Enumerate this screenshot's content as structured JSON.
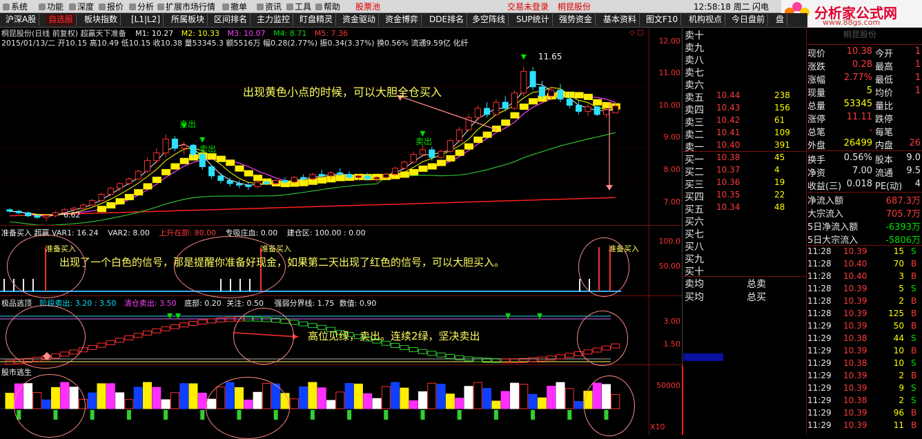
{
  "menu": {
    "items": [
      "系统",
      "功能",
      "深度",
      "报价",
      "分析",
      "扩展市场行情",
      "撤单",
      "资讯",
      "工具",
      "帮助"
    ],
    "stockpool": "股票池",
    "trade_status": "交易未登录",
    "stock_name": "桐昆股份",
    "clock": "12:58:18 周二",
    "flash": "闪电",
    "logo_main": "分析家公式网",
    "logo_url": "www.88gs.com"
  },
  "tabs": [
    "沪深A股",
    "自选股",
    "板块指数",
    "[L1|L2]",
    "所属板块",
    "区间排名",
    "主力监控",
    "盯盘精灵",
    "资金驱动",
    "资金博弈",
    "DDE排名",
    "多空阵线",
    "SUP统计",
    "强势资金",
    "基本资料",
    "图文F10",
    "机构视点",
    "今日盘前",
    "盘"
  ],
  "main_chart": {
    "title": "桐昆股份(日线 前复权) 超赢天下准备",
    "m1": "M1: 10.27",
    "m2": "M2: 10.33",
    "m3": "M3: 10.07",
    "m4": "M4: 8.71",
    "m5": "M5: 7.36",
    "ohlc": "2015/01/13/二 开10.15 高10.49 低10.15 收10.38 量53345.3 额5516万 幅0.28(2.77%) 振0.34(3.37%) 换0.56% 流通9.59亿 化纤",
    "y_ticks": [
      "12.00",
      "11.00",
      "10.00",
      "9.00",
      "8.00",
      "7.00"
    ],
    "high_label": "11.65",
    "low_label": "6.62",
    "sell_label": "卖出",
    "annotation": "出现黄色小点的时候，可以大胆全仓买入"
  },
  "panel2": {
    "title": "准备买入 超赢 VAR1: 16.24",
    "var2": "VAR2: 8.00",
    "rise": "上升在即: 80.00",
    "absorb": "专吸庄血: 0.00",
    "build": "建仓区: 100.00 : 0.00",
    "label": "准备买入",
    "y_ticks": [
      "100.0",
      "50.00"
    ],
    "annotation": "出现了一个白色的信号，那是提醒你准备好现金，如果第二天出现了红色的信号，可以大胆买入。"
  },
  "panel3": {
    "title": "极品逃顶",
    "stage": "阶段卖出: 3.20 : 3.50",
    "clear": "清仓卖出: 3.50",
    "bottom": "底部: 0.20",
    "attn": "关注: 0.50",
    "divider": "强弱分界线: 1.75",
    "value": "数值: 0.90",
    "y_ticks": [
      "3.00",
      "1.50"
    ],
    "annotation": "高位见绿，卖出。连续2绿，坚决卖出"
  },
  "panel4": {
    "title": "股市逃生",
    "y_tick": "50000",
    "scale": "X10"
  },
  "orderbook": {
    "sells": [
      {
        "label": "卖十",
        "price": "",
        "vol": ""
      },
      {
        "label": "卖九",
        "price": "",
        "vol": ""
      },
      {
        "label": "卖八",
        "price": "",
        "vol": ""
      },
      {
        "label": "卖七",
        "price": "",
        "vol": ""
      },
      {
        "label": "卖六",
        "price": "",
        "vol": ""
      },
      {
        "label": "卖五",
        "price": "10.44",
        "vol": "238"
      },
      {
        "label": "卖四",
        "price": "10.43",
        "vol": "156"
      },
      {
        "label": "卖三",
        "price": "10.42",
        "vol": "61"
      },
      {
        "label": "卖二",
        "price": "10.41",
        "vol": "109"
      },
      {
        "label": "卖一",
        "price": "10.40",
        "vol": "391"
      }
    ],
    "buys": [
      {
        "label": "买一",
        "price": "10.38",
        "vol": "45"
      },
      {
        "label": "买二",
        "price": "10.37",
        "vol": "4"
      },
      {
        "label": "买三",
        "price": "10.36",
        "vol": "19"
      },
      {
        "label": "买四",
        "price": "10.35",
        "vol": "22"
      },
      {
        "label": "买五",
        "price": "10.34",
        "vol": "48"
      },
      {
        "label": "买六",
        "price": "",
        "vol": ""
      },
      {
        "label": "买七",
        "price": "",
        "vol": ""
      },
      {
        "label": "买八",
        "price": "",
        "vol": ""
      },
      {
        "label": "买九",
        "price": "",
        "vol": ""
      },
      {
        "label": "买十",
        "price": "",
        "vol": ""
      }
    ],
    "sell_avg": "卖均",
    "sell_total": "总卖",
    "buy_avg": "买均",
    "buy_total": "总买"
  },
  "quote": {
    "header": "桐昆股份",
    "rows": [
      {
        "l1": "现价",
        "v1": "10.38",
        "l2": "今开",
        "v2": "1"
      },
      {
        "l1": "涨跌",
        "v1": "0.28",
        "l2": "最高",
        "v2": "1"
      },
      {
        "l1": "涨幅",
        "v1": "2.77%",
        "l2": "最低",
        "v2": "1"
      },
      {
        "l1": "现量",
        "v1": "5",
        "l2": "均价",
        "v2": "1"
      },
      {
        "l1": "总量",
        "v1": "53345",
        "l2": "量比",
        "v2": ""
      },
      {
        "l1": "涨停",
        "v1": "11.11",
        "l2": "跌停",
        "v2": ""
      },
      {
        "l1": "总笔",
        "v1": "-",
        "l2": "每笔",
        "v2": ""
      },
      {
        "l1": "外盘",
        "v1": "26499",
        "l2": "内盘",
        "v2": "26"
      }
    ],
    "rows2": [
      {
        "l1": "换手",
        "v1": "0.56%",
        "l2": "股本",
        "v2": "9.0"
      },
      {
        "l1": "净资",
        "v1": "7.00",
        "l2": "流通",
        "v2": "9.5"
      },
      {
        "l1": "收益(三)",
        "v1": "0.018",
        "l2": "PE(动)",
        "v2": "4"
      }
    ],
    "flows": [
      {
        "label": "净流入额",
        "value": "687.3万"
      },
      {
        "label": "大宗流入",
        "value": "705.7万"
      },
      {
        "label": "5日净流入额",
        "value": "-6393万"
      },
      {
        "label": "5日大宗流入",
        "value": "-5806万"
      }
    ]
  },
  "ticks": [
    {
      "time": "11:28",
      "price": "10.39",
      "vol": "15",
      "side": "S"
    },
    {
      "time": "11:28",
      "price": "10.40",
      "vol": "70",
      "side": "B"
    },
    {
      "time": "11:28",
      "price": "10.40",
      "vol": "3",
      "side": "B"
    },
    {
      "time": "11:28",
      "price": "10.39",
      "vol": "5",
      "side": "S"
    },
    {
      "time": "11:28",
      "price": "10.39",
      "vol": "2",
      "side": "B"
    },
    {
      "time": "11:28",
      "price": "10.39",
      "vol": "125",
      "side": "B"
    },
    {
      "time": "11:29",
      "price": "10.39",
      "vol": "50",
      "side": "B"
    },
    {
      "time": "11:29",
      "price": "10.38",
      "vol": "44",
      "side": "S"
    },
    {
      "time": "11:29",
      "price": "10.39",
      "vol": "10",
      "side": "B"
    },
    {
      "time": "11:29",
      "price": "10.38",
      "vol": "10",
      "side": "S"
    },
    {
      "time": "11:29",
      "price": "10.39",
      "vol": "2",
      "side": "B"
    },
    {
      "time": "11:29",
      "price": "10.39",
      "vol": "9",
      "side": "S"
    },
    {
      "time": "11:29",
      "price": "10.38",
      "vol": "2",
      "side": "S"
    },
    {
      "time": "11:29",
      "price": "10.39",
      "vol": "96",
      "side": "B"
    },
    {
      "time": "11:29",
      "price": "10.39",
      "vol": "11",
      "side": "B"
    }
  ],
  "chart_data": {
    "type": "candlestick",
    "y_range": [
      6.5,
      12.3
    ],
    "candles": [
      [
        7.0,
        7.05,
        6.9,
        6.95
      ],
      [
        6.95,
        7.0,
        6.85,
        6.9
      ],
      [
        6.9,
        6.95,
        6.75,
        6.8
      ],
      [
        6.8,
        6.85,
        6.7,
        6.75
      ],
      [
        6.75,
        6.85,
        6.62,
        6.8
      ],
      [
        6.8,
        6.95,
        6.75,
        6.9
      ],
      [
        6.9,
        7.05,
        6.85,
        7.0
      ],
      [
        7.0,
        7.1,
        6.95,
        7.05
      ],
      [
        7.05,
        7.2,
        7.0,
        7.15
      ],
      [
        7.15,
        7.35,
        7.1,
        7.3
      ],
      [
        7.3,
        7.55,
        7.25,
        7.5
      ],
      [
        7.5,
        7.75,
        7.45,
        7.7
      ],
      [
        7.7,
        7.9,
        7.6,
        7.85
      ],
      [
        7.85,
        8.05,
        7.8,
        8.0
      ],
      [
        8.0,
        8.3,
        7.95,
        8.25
      ],
      [
        8.25,
        8.7,
        8.2,
        8.6
      ],
      [
        8.6,
        9.0,
        8.5,
        8.85
      ],
      [
        8.85,
        9.45,
        8.7,
        9.3
      ],
      [
        9.3,
        9.4,
        8.9,
        9.0
      ],
      [
        9.0,
        9.2,
        8.8,
        9.1
      ],
      [
        9.1,
        9.15,
        8.7,
        8.8
      ],
      [
        8.8,
        8.9,
        8.3,
        8.4
      ],
      [
        8.4,
        8.45,
        8.0,
        8.1
      ],
      [
        8.1,
        8.2,
        7.85,
        7.95
      ],
      [
        7.95,
        8.05,
        7.75,
        7.85
      ],
      [
        7.85,
        7.95,
        7.7,
        7.8
      ],
      [
        7.8,
        7.9,
        7.65,
        7.75
      ],
      [
        7.75,
        7.95,
        7.7,
        7.9
      ],
      [
        7.9,
        8.0,
        7.8,
        7.85
      ],
      [
        7.85,
        8.0,
        7.8,
        7.95
      ],
      [
        7.95,
        8.05,
        7.85,
        7.9
      ],
      [
        7.9,
        8.1,
        7.85,
        8.05
      ],
      [
        8.05,
        8.15,
        7.95,
        8.0
      ],
      [
        8.0,
        8.2,
        7.95,
        8.15
      ],
      [
        8.15,
        8.3,
        8.05,
        8.1
      ],
      [
        8.1,
        8.25,
        8.0,
        8.2
      ],
      [
        8.2,
        8.35,
        8.1,
        8.15
      ],
      [
        8.15,
        8.25,
        8.0,
        8.05
      ],
      [
        8.05,
        8.15,
        7.95,
        8.1
      ],
      [
        8.1,
        8.2,
        7.95,
        8.0
      ],
      [
        8.0,
        8.1,
        7.9,
        8.05
      ],
      [
        8.05,
        8.2,
        8.0,
        8.15
      ],
      [
        8.15,
        8.4,
        8.1,
        8.35
      ],
      [
        8.35,
        8.6,
        8.3,
        8.55
      ],
      [
        8.55,
        8.9,
        8.5,
        8.8
      ],
      [
        8.8,
        9.1,
        8.7,
        8.95
      ],
      [
        8.95,
        9.05,
        8.6,
        8.7
      ],
      [
        8.7,
        8.95,
        8.65,
        8.9
      ],
      [
        8.9,
        9.3,
        8.85,
        9.25
      ],
      [
        9.25,
        9.7,
        9.2,
        9.6
      ],
      [
        9.6,
        10.1,
        9.55,
        10.0
      ],
      [
        10.0,
        10.4,
        9.9,
        10.3
      ],
      [
        10.3,
        10.5,
        10.0,
        10.1
      ],
      [
        10.1,
        10.6,
        10.05,
        10.5
      ],
      [
        10.5,
        10.7,
        10.2,
        10.3
      ],
      [
        10.3,
        10.9,
        10.25,
        10.8
      ],
      [
        10.8,
        11.65,
        10.7,
        11.5
      ],
      [
        11.5,
        11.65,
        10.9,
        11.0
      ],
      [
        11.0,
        11.2,
        10.6,
        10.7
      ],
      [
        10.7,
        11.0,
        10.55,
        10.9
      ],
      [
        10.9,
        11.1,
        10.5,
        10.6
      ],
      [
        10.6,
        10.8,
        10.3,
        10.4
      ],
      [
        10.4,
        10.55,
        10.1,
        10.2
      ],
      [
        10.2,
        10.45,
        10.05,
        10.35
      ],
      [
        10.35,
        10.4,
        10.05,
        10.1
      ],
      [
        10.1,
        10.3,
        10.0,
        10.25
      ],
      [
        10.15,
        10.49,
        10.15,
        10.38
      ]
    ]
  }
}
